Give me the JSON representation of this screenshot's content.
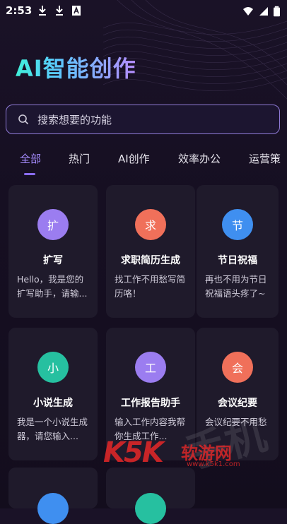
{
  "status_bar": {
    "time": "2:53",
    "icons_left": [
      "download-icon",
      "download-icon",
      "app-a-icon"
    ],
    "icons_right": [
      "wifi-icon",
      "signal-icon",
      "battery-icon"
    ]
  },
  "app_title": "AI智能创作",
  "search": {
    "placeholder": "搜索想要的功能"
  },
  "tabs": [
    {
      "label": "全部",
      "active": true
    },
    {
      "label": "热门",
      "active": false
    },
    {
      "label": "AI创作",
      "active": false
    },
    {
      "label": "效率办公",
      "active": false
    },
    {
      "label": "运营策",
      "active": false
    }
  ],
  "cards": [
    {
      "badge": "扩",
      "badge_color": "#9b7df0",
      "title": "扩写",
      "desc": "Hello，我是您的扩写助手，请输..."
    },
    {
      "badge": "求",
      "badge_color": "#f0705a",
      "title": "求职简历生成",
      "desc": "找工作不用愁写简历咯！"
    },
    {
      "badge": "节",
      "badge_color": "#3f8ff0",
      "title": "节日祝福",
      "desc": "再也不用为节日祝福语头疼了~"
    },
    {
      "badge": "小",
      "badge_color": "#26c0a0",
      "title": "小说生成",
      "desc": "我是一个小说生成器，请您输入..."
    },
    {
      "badge": "工",
      "badge_color": "#9b7df0",
      "title": "工作报告助手",
      "desc": "输入工作内容我帮你生成工作..."
    },
    {
      "badge": "会",
      "badge_color": "#f0705a",
      "title": "会议纪要",
      "desc": "会议纪要不用愁"
    }
  ],
  "partial_cards": [
    {
      "badge_color": "#3f8ff0"
    },
    {
      "badge_color": "#26c0a0"
    }
  ],
  "watermark": {
    "logo": "K5K",
    "text": "软游网",
    "url": "www.k5k1.com"
  }
}
